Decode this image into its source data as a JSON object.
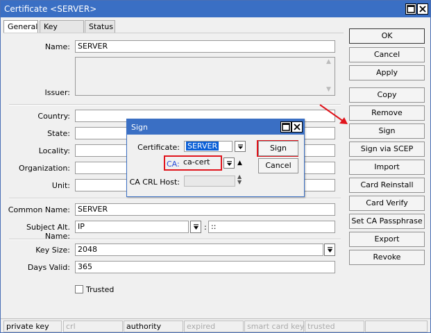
{
  "window": {
    "title": "Certificate <SERVER>"
  },
  "tabs": [
    "General",
    "Key Usage",
    "Status"
  ],
  "form": {
    "name_label": "Name:",
    "name_value": "SERVER",
    "issuer_label": "Issuer:",
    "country_label": "Country:",
    "state_label": "State:",
    "locality_label": "Locality:",
    "organization_label": "Organization:",
    "unit_label": "Unit:",
    "common_name_label": "Common Name:",
    "common_name_value": "SERVER",
    "subject_alt_label": "Subject Alt. Name:",
    "subject_alt_type": "IP",
    "subject_alt_sep": ":",
    "subject_alt_value": "::",
    "key_size_label": "Key Size:",
    "key_size_value": "2048",
    "days_valid_label": "Days Valid:",
    "days_valid_value": "365",
    "trusted_label": "Trusted"
  },
  "buttons": [
    "OK",
    "Cancel",
    "Apply",
    "Copy",
    "Remove",
    "Sign",
    "Sign via SCEP",
    "Import",
    "Card Reinstall",
    "Card Verify",
    "Set CA Passphrase",
    "Export",
    "Revoke"
  ],
  "status_bar": [
    "private key",
    "crl",
    "authority",
    "expired",
    "smart card key",
    "trusted",
    ""
  ],
  "sign_dialog": {
    "title": "Sign",
    "certificate_label": "Certificate:",
    "certificate_value": "SERVER",
    "ca_label": "CA:",
    "ca_value": "ca-cert",
    "crl_host_label": "CA CRL Host:",
    "crl_host_value": "",
    "sign_button": "Sign",
    "cancel_button": "Cancel"
  },
  "colors": {
    "titlebar": "#3a6fc4",
    "highlight": "#e0141c",
    "selection": "#0a5fd7"
  }
}
